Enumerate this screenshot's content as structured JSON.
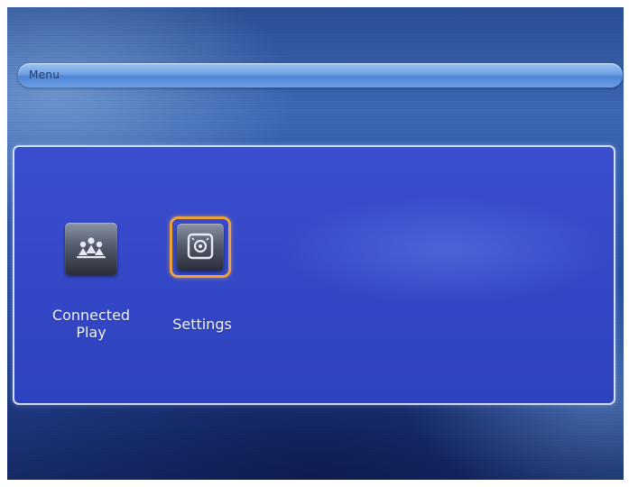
{
  "menu_bar": {
    "title": "Menu"
  },
  "items": [
    {
      "label": "Connected\nPlay",
      "icon": "connected-play-icon",
      "selected": false
    },
    {
      "label": "Settings",
      "icon": "settings-icon",
      "selected": true
    }
  ],
  "colors": {
    "selection_border": "#f0a23a",
    "panel_background": "#3549c9",
    "menu_bar": "#6f9fe2"
  }
}
